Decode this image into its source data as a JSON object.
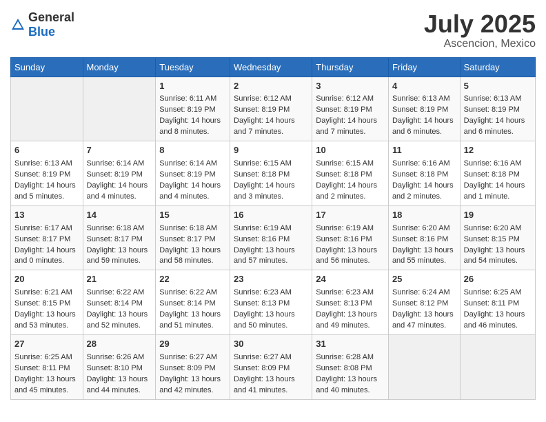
{
  "logo": {
    "general": "General",
    "blue": "Blue"
  },
  "title": {
    "month_year": "July 2025",
    "location": "Ascencion, Mexico"
  },
  "days_of_week": [
    "Sunday",
    "Monday",
    "Tuesday",
    "Wednesday",
    "Thursday",
    "Friday",
    "Saturday"
  ],
  "weeks": [
    [
      {
        "day": "",
        "sunrise": "",
        "sunset": "",
        "daylight": ""
      },
      {
        "day": "",
        "sunrise": "",
        "sunset": "",
        "daylight": ""
      },
      {
        "day": "1",
        "sunrise": "Sunrise: 6:11 AM",
        "sunset": "Sunset: 8:19 PM",
        "daylight": "Daylight: 14 hours and 8 minutes."
      },
      {
        "day": "2",
        "sunrise": "Sunrise: 6:12 AM",
        "sunset": "Sunset: 8:19 PM",
        "daylight": "Daylight: 14 hours and 7 minutes."
      },
      {
        "day": "3",
        "sunrise": "Sunrise: 6:12 AM",
        "sunset": "Sunset: 8:19 PM",
        "daylight": "Daylight: 14 hours and 7 minutes."
      },
      {
        "day": "4",
        "sunrise": "Sunrise: 6:13 AM",
        "sunset": "Sunset: 8:19 PM",
        "daylight": "Daylight: 14 hours and 6 minutes."
      },
      {
        "day": "5",
        "sunrise": "Sunrise: 6:13 AM",
        "sunset": "Sunset: 8:19 PM",
        "daylight": "Daylight: 14 hours and 6 minutes."
      }
    ],
    [
      {
        "day": "6",
        "sunrise": "Sunrise: 6:13 AM",
        "sunset": "Sunset: 8:19 PM",
        "daylight": "Daylight: 14 hours and 5 minutes."
      },
      {
        "day": "7",
        "sunrise": "Sunrise: 6:14 AM",
        "sunset": "Sunset: 8:19 PM",
        "daylight": "Daylight: 14 hours and 4 minutes."
      },
      {
        "day": "8",
        "sunrise": "Sunrise: 6:14 AM",
        "sunset": "Sunset: 8:19 PM",
        "daylight": "Daylight: 14 hours and 4 minutes."
      },
      {
        "day": "9",
        "sunrise": "Sunrise: 6:15 AM",
        "sunset": "Sunset: 8:18 PM",
        "daylight": "Daylight: 14 hours and 3 minutes."
      },
      {
        "day": "10",
        "sunrise": "Sunrise: 6:15 AM",
        "sunset": "Sunset: 8:18 PM",
        "daylight": "Daylight: 14 hours and 2 minutes."
      },
      {
        "day": "11",
        "sunrise": "Sunrise: 6:16 AM",
        "sunset": "Sunset: 8:18 PM",
        "daylight": "Daylight: 14 hours and 2 minutes."
      },
      {
        "day": "12",
        "sunrise": "Sunrise: 6:16 AM",
        "sunset": "Sunset: 8:18 PM",
        "daylight": "Daylight: 14 hours and 1 minute."
      }
    ],
    [
      {
        "day": "13",
        "sunrise": "Sunrise: 6:17 AM",
        "sunset": "Sunset: 8:17 PM",
        "daylight": "Daylight: 14 hours and 0 minutes."
      },
      {
        "day": "14",
        "sunrise": "Sunrise: 6:18 AM",
        "sunset": "Sunset: 8:17 PM",
        "daylight": "Daylight: 13 hours and 59 minutes."
      },
      {
        "day": "15",
        "sunrise": "Sunrise: 6:18 AM",
        "sunset": "Sunset: 8:17 PM",
        "daylight": "Daylight: 13 hours and 58 minutes."
      },
      {
        "day": "16",
        "sunrise": "Sunrise: 6:19 AM",
        "sunset": "Sunset: 8:16 PM",
        "daylight": "Daylight: 13 hours and 57 minutes."
      },
      {
        "day": "17",
        "sunrise": "Sunrise: 6:19 AM",
        "sunset": "Sunset: 8:16 PM",
        "daylight": "Daylight: 13 hours and 56 minutes."
      },
      {
        "day": "18",
        "sunrise": "Sunrise: 6:20 AM",
        "sunset": "Sunset: 8:16 PM",
        "daylight": "Daylight: 13 hours and 55 minutes."
      },
      {
        "day": "19",
        "sunrise": "Sunrise: 6:20 AM",
        "sunset": "Sunset: 8:15 PM",
        "daylight": "Daylight: 13 hours and 54 minutes."
      }
    ],
    [
      {
        "day": "20",
        "sunrise": "Sunrise: 6:21 AM",
        "sunset": "Sunset: 8:15 PM",
        "daylight": "Daylight: 13 hours and 53 minutes."
      },
      {
        "day": "21",
        "sunrise": "Sunrise: 6:22 AM",
        "sunset": "Sunset: 8:14 PM",
        "daylight": "Daylight: 13 hours and 52 minutes."
      },
      {
        "day": "22",
        "sunrise": "Sunrise: 6:22 AM",
        "sunset": "Sunset: 8:14 PM",
        "daylight": "Daylight: 13 hours and 51 minutes."
      },
      {
        "day": "23",
        "sunrise": "Sunrise: 6:23 AM",
        "sunset": "Sunset: 8:13 PM",
        "daylight": "Daylight: 13 hours and 50 minutes."
      },
      {
        "day": "24",
        "sunrise": "Sunrise: 6:23 AM",
        "sunset": "Sunset: 8:13 PM",
        "daylight": "Daylight: 13 hours and 49 minutes."
      },
      {
        "day": "25",
        "sunrise": "Sunrise: 6:24 AM",
        "sunset": "Sunset: 8:12 PM",
        "daylight": "Daylight: 13 hours and 47 minutes."
      },
      {
        "day": "26",
        "sunrise": "Sunrise: 6:25 AM",
        "sunset": "Sunset: 8:11 PM",
        "daylight": "Daylight: 13 hours and 46 minutes."
      }
    ],
    [
      {
        "day": "27",
        "sunrise": "Sunrise: 6:25 AM",
        "sunset": "Sunset: 8:11 PM",
        "daylight": "Daylight: 13 hours and 45 minutes."
      },
      {
        "day": "28",
        "sunrise": "Sunrise: 6:26 AM",
        "sunset": "Sunset: 8:10 PM",
        "daylight": "Daylight: 13 hours and 44 minutes."
      },
      {
        "day": "29",
        "sunrise": "Sunrise: 6:27 AM",
        "sunset": "Sunset: 8:09 PM",
        "daylight": "Daylight: 13 hours and 42 minutes."
      },
      {
        "day": "30",
        "sunrise": "Sunrise: 6:27 AM",
        "sunset": "Sunset: 8:09 PM",
        "daylight": "Daylight: 13 hours and 41 minutes."
      },
      {
        "day": "31",
        "sunrise": "Sunrise: 6:28 AM",
        "sunset": "Sunset: 8:08 PM",
        "daylight": "Daylight: 13 hours and 40 minutes."
      },
      {
        "day": "",
        "sunrise": "",
        "sunset": "",
        "daylight": ""
      },
      {
        "day": "",
        "sunrise": "",
        "sunset": "",
        "daylight": ""
      }
    ]
  ]
}
